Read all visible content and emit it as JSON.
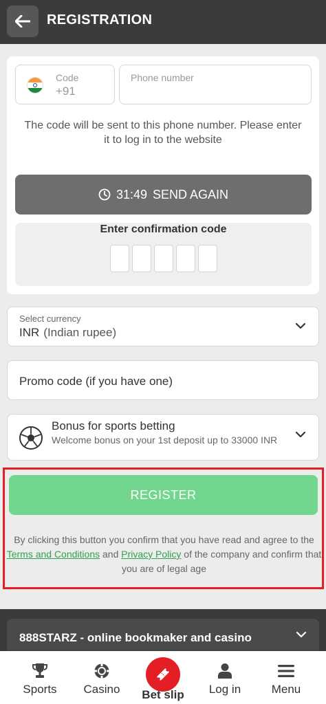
{
  "header": {
    "title": "REGISTRATION"
  },
  "phone": {
    "code_label": "Code",
    "code_value": "+91",
    "phone_placeholder": "Phone number",
    "hint": "The code will be sent to this phone number. Please enter it to log in to the website"
  },
  "send_again": {
    "timer": "31:49",
    "label": "SEND AGAIN"
  },
  "confirmation": {
    "label": "Enter confirmation code",
    "digit_count": 5
  },
  "currency": {
    "label": "Select currency",
    "code": "INR",
    "name": "(Indian rupee)"
  },
  "promo": {
    "placeholder": "Promo code (if you have one)"
  },
  "bonus": {
    "title": "Bonus for sports betting",
    "description": "Welcome bonus on your 1st deposit up to 33000 INR"
  },
  "register": {
    "button_label": "REGISTER",
    "terms_prefix": "By clicking this button you confirm that you have read and agree to the",
    "terms_link": "Terms and Conditions",
    "terms_and": "and",
    "privacy_link": "Privacy Policy",
    "terms_suffix": "of the company and confirm that you are of legal age"
  },
  "about": {
    "title": "888STARZ - online bookmaker and casino"
  },
  "bottom_nav": {
    "sports": "Sports",
    "casino": "Casino",
    "bet_slip": "Bet slip",
    "log_in": "Log in",
    "menu": "Menu"
  },
  "colors": {
    "header_bg": "#3b3b3b",
    "register_green": "#72d68f",
    "link_green": "#2ea34f",
    "highlight_red": "#e31e24",
    "send_button_gray": "#6e6e6e"
  },
  "icons": [
    "back-arrow-icon",
    "india-flag-icon",
    "clock-icon",
    "chevron-down-icon",
    "soccer-ball-icon",
    "trophy-icon",
    "casino-chip-icon",
    "ticket-icon",
    "user-icon",
    "menu-icon"
  ]
}
